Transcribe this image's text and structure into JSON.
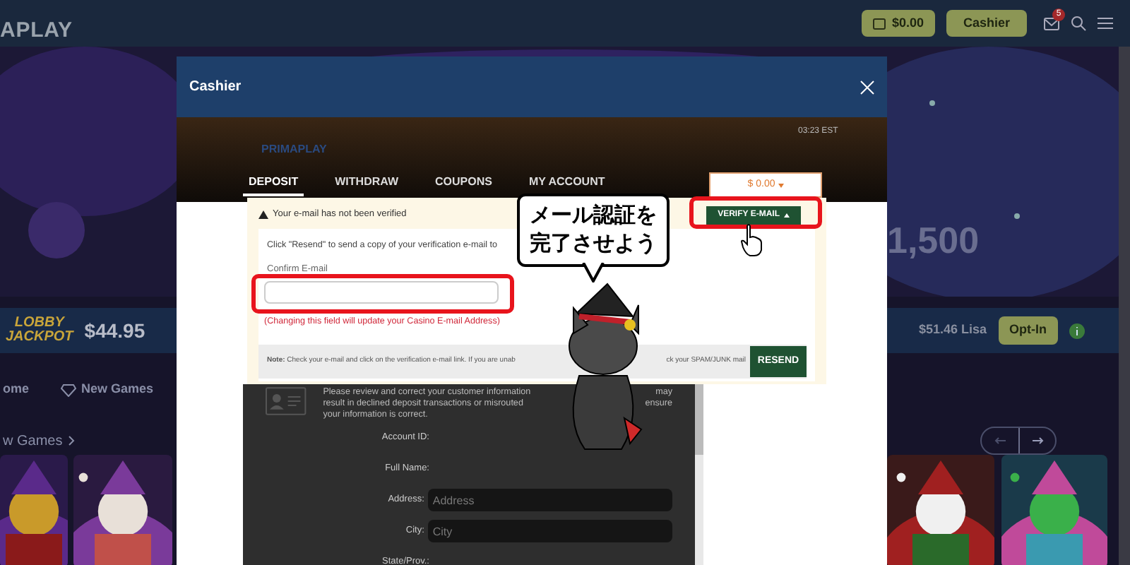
{
  "header": {
    "logo": "APLAY",
    "balance": "$0.00",
    "cashier": "Cashier",
    "mail_badge": "5"
  },
  "hero": {
    "promo": "1,500"
  },
  "jackpot": {
    "logo_top": "LOBBY",
    "logo_bottom": "JACKPOT",
    "amount": "$44.95",
    "winner": "$51.46 Lisa",
    "opt_in": "Opt-In"
  },
  "nav": [
    {
      "label": "ome",
      "kind": "home"
    },
    {
      "label": "New Games",
      "kind": "diamond"
    }
  ],
  "section": {
    "title": "w Games"
  },
  "modal": {
    "title": "Cashier",
    "brand": "PRIMAPLAY",
    "time": "03:23 EST",
    "tabs": [
      {
        "label": "DEPOSIT",
        "selected": true
      },
      {
        "label": "WITHDRAW",
        "selected": false
      },
      {
        "label": "COUPONS",
        "selected": false
      },
      {
        "label": "MY ACCOUNT",
        "selected": false
      }
    ],
    "amount": "$ 0.00",
    "warning": "Your e-mail has not been verified",
    "verify_button": "VERIFY E-MAIL",
    "instruction": "Click \"Resend\" to send a copy of your verification e-mail to",
    "field_label": "Confirm E-mail",
    "helper": "(Changing this field will update your Casino E-mail Address)",
    "note": "**Note:** Check your e-mail and click on the verification e-mail link. If you are unab",
    "note_end": "ck your SPAM/JUNK mail",
    "resend": "RESEND",
    "info_lines": [
      {
        "text": "Please review and correct your customer information",
        "end": "may"
      },
      {
        "text": "result in declined deposit transactions or misrouted",
        "end": "ensure"
      },
      {
        "text": "your information is correct."
      }
    ],
    "form": [
      {
        "label": "Account ID:",
        "kind": "text"
      },
      {
        "label": "Full Name:",
        "kind": "text"
      },
      {
        "label": "Address:",
        "kind": "input",
        "placeholder": "Address"
      },
      {
        "label": "City:",
        "kind": "input",
        "placeholder": "City"
      },
      {
        "label": "State/Prov.:",
        "kind": "text"
      }
    ]
  },
  "callout": {
    "text": "メール認証を完了させよう"
  }
}
